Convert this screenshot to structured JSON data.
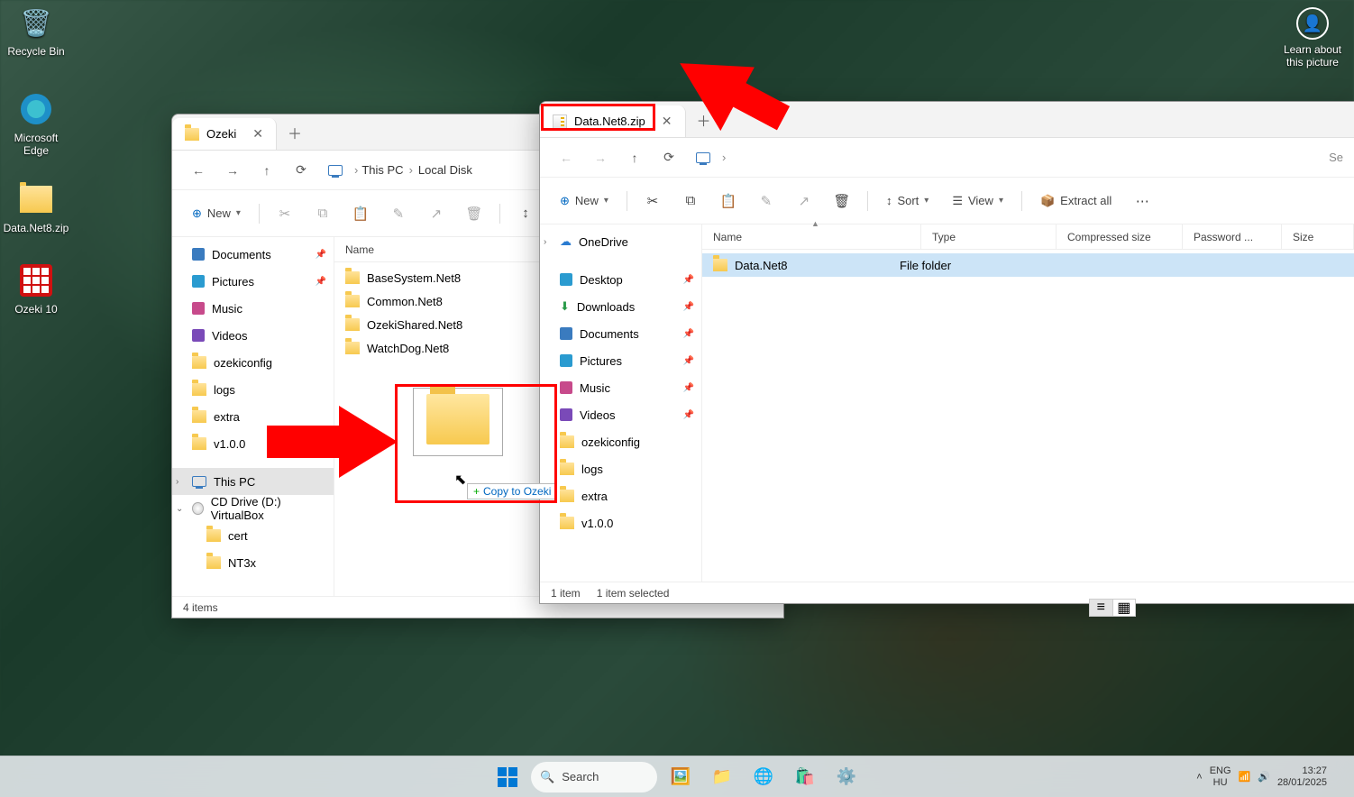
{
  "desktop": {
    "icons": [
      {
        "name": "recycle-bin",
        "label": "Recycle Bin",
        "glyph": "🗑️"
      },
      {
        "name": "edge",
        "label": "Microsoft\nEdge",
        "glyph": "🌐"
      },
      {
        "name": "zip",
        "label": "Data.Net8.zip",
        "glyph": "zip"
      },
      {
        "name": "ozeki10",
        "label": "Ozeki 10",
        "glyph": "grid-red"
      }
    ],
    "learn_label": "Learn about\nthis picture"
  },
  "window1": {
    "tab_title": "Ozeki",
    "breadcrumb": [
      "This PC",
      "Local Disk"
    ],
    "new_label": "New",
    "sidebar": [
      {
        "kind": "item",
        "icon": "doc",
        "label": "Documents",
        "pin": true
      },
      {
        "kind": "item",
        "icon": "pic",
        "label": "Pictures",
        "pin": true
      },
      {
        "kind": "item",
        "icon": "mus",
        "label": "Music",
        "pin": false
      },
      {
        "kind": "item",
        "icon": "vid",
        "label": "Videos",
        "pin": false
      },
      {
        "kind": "item",
        "icon": "fld",
        "label": "ozekiconfig"
      },
      {
        "kind": "item",
        "icon": "fld",
        "label": "logs"
      },
      {
        "kind": "item",
        "icon": "fld",
        "label": "extra"
      },
      {
        "kind": "item",
        "icon": "fld",
        "label": "v1.0.0"
      },
      {
        "kind": "sep"
      },
      {
        "kind": "item",
        "icon": "pc",
        "label": "This PC",
        "chev": ">",
        "selected": true
      },
      {
        "kind": "item",
        "icon": "cd",
        "label": "CD Drive (D:) VirtualBox",
        "chev": "v"
      },
      {
        "kind": "sub",
        "icon": "fld",
        "label": "cert"
      },
      {
        "kind": "sub",
        "icon": "fld",
        "label": "NT3x"
      }
    ],
    "col_name": "Name",
    "files": [
      {
        "label": "BaseSystem.Net8"
      },
      {
        "label": "Common.Net8"
      },
      {
        "label": "OzekiShared.Net8"
      },
      {
        "label": "WatchDog.Net8"
      }
    ],
    "status": "4 items",
    "drag_tooltip": "Copy to Ozeki"
  },
  "window2": {
    "tab_title": "Data.Net8.zip",
    "search_placeholder": "Se",
    "new_label": "New",
    "sort_label": "Sort",
    "view_label": "View",
    "extract_label": "Extract all",
    "sidebar": [
      {
        "kind": "item",
        "icon": "cloud",
        "label": "OneDrive",
        "chev": ">"
      },
      {
        "kind": "sep"
      },
      {
        "kind": "item",
        "icon": "desk",
        "label": "Desktop",
        "pin": true
      },
      {
        "kind": "item",
        "icon": "dl",
        "label": "Downloads",
        "pin": true
      },
      {
        "kind": "item",
        "icon": "doc",
        "label": "Documents",
        "pin": true
      },
      {
        "kind": "item",
        "icon": "pic",
        "label": "Pictures",
        "pin": true
      },
      {
        "kind": "item",
        "icon": "mus",
        "label": "Music",
        "pin": true
      },
      {
        "kind": "item",
        "icon": "vid",
        "label": "Videos",
        "pin": true
      },
      {
        "kind": "item",
        "icon": "fld",
        "label": "ozekiconfig"
      },
      {
        "kind": "item",
        "icon": "fld",
        "label": "logs"
      },
      {
        "kind": "item",
        "icon": "fld",
        "label": "extra"
      },
      {
        "kind": "item",
        "icon": "fld",
        "label": "v1.0.0"
      }
    ],
    "cols": [
      "Name",
      "Type",
      "Compressed size",
      "Password ...",
      "Size"
    ],
    "files": [
      {
        "name": "Data.Net8",
        "type": "File folder"
      }
    ],
    "status_items": "1 item",
    "status_selected": "1 item selected"
  },
  "taskbar": {
    "search_placeholder": "Search",
    "tray": {
      "lang1": "ENG",
      "lang2": "HU",
      "time": "13:27",
      "date": "28/01/2025"
    }
  }
}
